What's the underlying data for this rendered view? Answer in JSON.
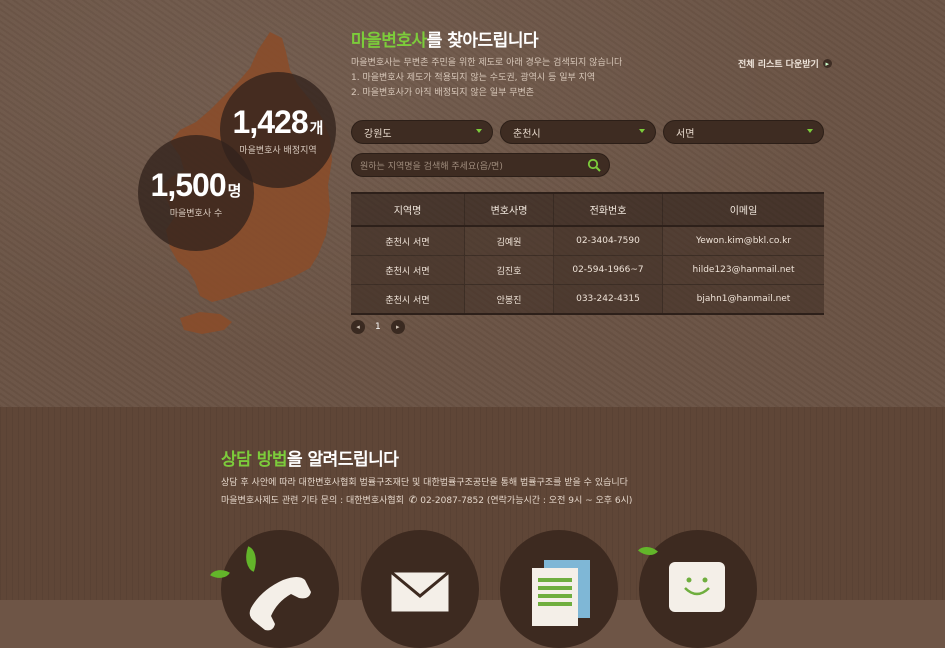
{
  "locator": {
    "title_highlight": "마을변호사",
    "title_rest": "를 찾아드립니다",
    "description": [
      "마을변호사는 무변촌 주민을 위한 제도로 아래 경우는 검색되지 않습니다",
      "1. 마을변호사 제도가 적용되지 않는 수도권, 광역시 등 일부 지역",
      "2. 마을변호사가 아직 배정되지 않은 일부 무변촌"
    ],
    "download_label": "전체 리스트 다운받기"
  },
  "stats": {
    "regions_value": "1,428",
    "regions_unit": "개",
    "regions_label": "마을변호사 배정지역",
    "lawyers_value": "1,500",
    "lawyers_unit": "명",
    "lawyers_label": "마을변호사 수"
  },
  "filters": {
    "province": "강원도",
    "city": "춘천시",
    "district": "서면",
    "search_placeholder": "원하는 지역명을 검색해 주세요(읍/면)"
  },
  "table": {
    "headers": [
      "지역명",
      "변호사명",
      "전화번호",
      "이메일"
    ],
    "rows": [
      [
        "춘천시 서면",
        "김예원",
        "02-3404-7590",
        "Yewon.kim@bkl.co.kr"
      ],
      [
        "춘천시 서면",
        "김진호",
        "02-594-1966~7",
        "hilde123@hanmail.net"
      ],
      [
        "춘천시 서면",
        "안봉진",
        "033-242-4315",
        "bjahn1@hanmail.net"
      ]
    ]
  },
  "pagination": {
    "current": "1"
  },
  "consult": {
    "title_highlight": "상담 방법",
    "title_rest": "을 알려드립니다",
    "line1": "상담 후 사안에 따라 대한변호사협회 법률구조재단 및 대한법률구조공단을 통해 법률구조를 받을 수 있습니다",
    "line2_prefix": "마을변호사제도 관련 기타 문의 : 대한변호사협회",
    "line2_phone": "02-2087-7852",
    "line2_suffix": "(연락가능시간 : 오전 9시 ~ 오후 6시)"
  },
  "colors": {
    "accent": "#7ccc3b",
    "bg_top": "#6a5344",
    "bg_bottom": "#5f4637"
  },
  "icons": [
    "phone-icon",
    "mail-icon",
    "document-icon",
    "smile-chat-icon"
  ]
}
